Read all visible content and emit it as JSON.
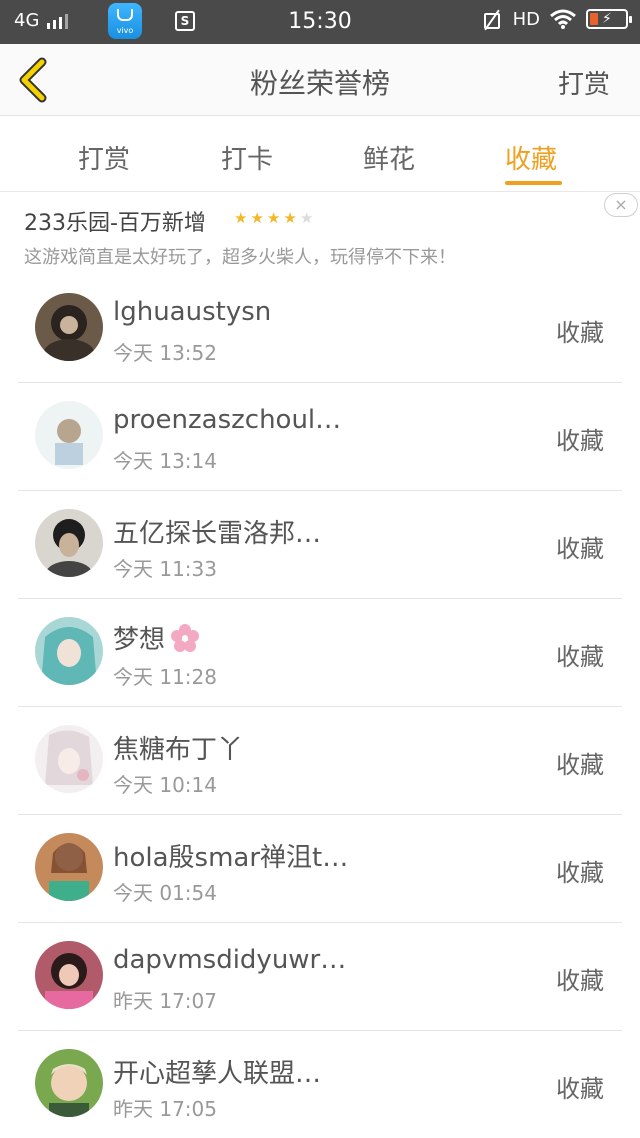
{
  "status_bar": {
    "network": "4G",
    "store_app_label": "vivo",
    "sim_label": "S",
    "time": "15:30",
    "hd_label": "HD"
  },
  "header": {
    "title": "粉丝荣誉榜",
    "action_label": "打赏",
    "back_icon": "chevron-left-icon"
  },
  "tabs": [
    {
      "label": "打赏",
      "active": false
    },
    {
      "label": "打卡",
      "active": false
    },
    {
      "label": "鲜花",
      "active": false
    },
    {
      "label": "收藏",
      "active": true
    }
  ],
  "ad": {
    "title": "233乐园-百万新增",
    "rating": 4,
    "rating_max": 5,
    "description": "这游戏简直是太好玩了，超多火柴人，玩得停不下来！",
    "close_label": "×"
  },
  "list": [
    {
      "name": "lghuaustysn",
      "time": "今天 13:52",
      "action": "收藏"
    },
    {
      "name": "proenzaszchoul…",
      "time": "今天 13:14",
      "action": "收藏"
    },
    {
      "name": "五亿探长雷洛邦…",
      "time": "今天 11:33",
      "action": "收藏"
    },
    {
      "name": "梦想",
      "time": "今天 11:28",
      "action": "收藏"
    },
    {
      "name": "焦糖布丁丫",
      "time": "今天 10:14",
      "action": "收藏"
    },
    {
      "name": "hola殷smar禅沮t…",
      "time": "今天 01:54",
      "action": "收藏"
    },
    {
      "name": "dapvmsdidyuwr…",
      "time": "昨天 17:07",
      "action": "收藏"
    },
    {
      "name": "开心超孳人联盟…",
      "time": "昨天 17:05",
      "action": "收藏"
    }
  ],
  "colors": {
    "accent": "#f0a020",
    "status_bar": "#4a4a4a",
    "star": "#f2b827"
  }
}
